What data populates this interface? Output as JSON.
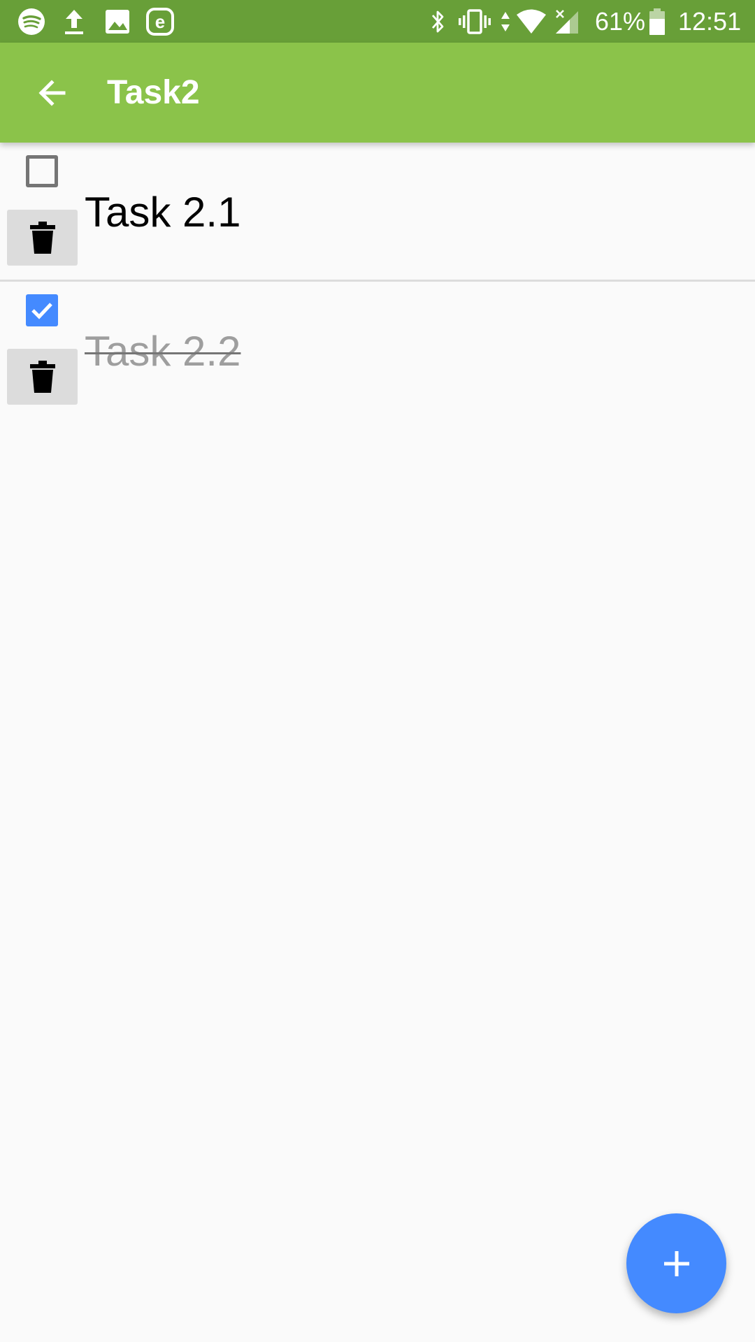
{
  "status_bar": {
    "battery_percent": "61%",
    "time": "12:51",
    "left_icons": [
      "spotify-icon",
      "upload-icon",
      "image-icon",
      "e-app-icon"
    ],
    "right_icons": [
      "bluetooth-icon",
      "vibrate-icon",
      "data-arrows-icon",
      "wifi-icon",
      "signal-icon",
      "battery-icon"
    ]
  },
  "app_bar": {
    "title": "Task2",
    "back_icon": "arrow-left-icon"
  },
  "tasks": [
    {
      "label": "Task 2.1",
      "checked": false
    },
    {
      "label": "Task 2.2",
      "checked": true
    }
  ],
  "fab": {
    "icon": "plus-icon"
  },
  "colors": {
    "status_bar": "#689f38",
    "app_bar": "#8bc34a",
    "accent": "#448aff",
    "background": "#fafafa"
  }
}
